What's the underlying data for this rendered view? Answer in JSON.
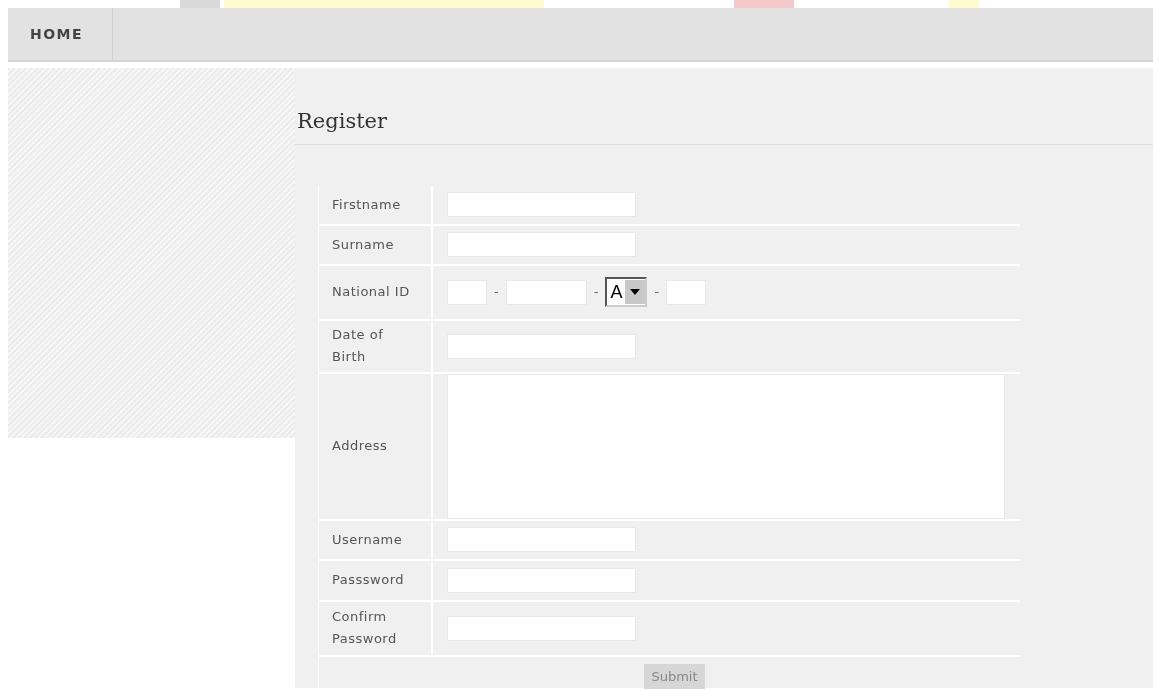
{
  "nav": {
    "tabs": [
      {
        "label": "HOME",
        "selected": true
      }
    ]
  },
  "form": {
    "title": "Register",
    "rows": [
      {
        "label": "Firstname",
        "kind": "text"
      },
      {
        "label": "Surname",
        "kind": "text"
      },
      {
        "label": "National ID",
        "kind": "national_id",
        "parts": [
          {
            "kind": "short_field"
          },
          {
            "kind": "separator",
            "text": "-"
          },
          {
            "kind": "long_field"
          },
          {
            "kind": "separator",
            "text": "-"
          },
          {
            "kind": "select",
            "value": "A"
          },
          {
            "kind": "separator",
            "text": "-"
          },
          {
            "kind": "short_field"
          }
        ]
      },
      {
        "label": "Date of Birth",
        "kind": "text"
      },
      {
        "label": "Address",
        "kind": "textarea"
      },
      {
        "label": "Username",
        "kind": "text"
      },
      {
        "label": "Passsword",
        "kind": "password"
      },
      {
        "label": "Confirm Password",
        "kind": "password"
      }
    ],
    "submit": {
      "label": "Submit",
      "disabled": true
    }
  }
}
